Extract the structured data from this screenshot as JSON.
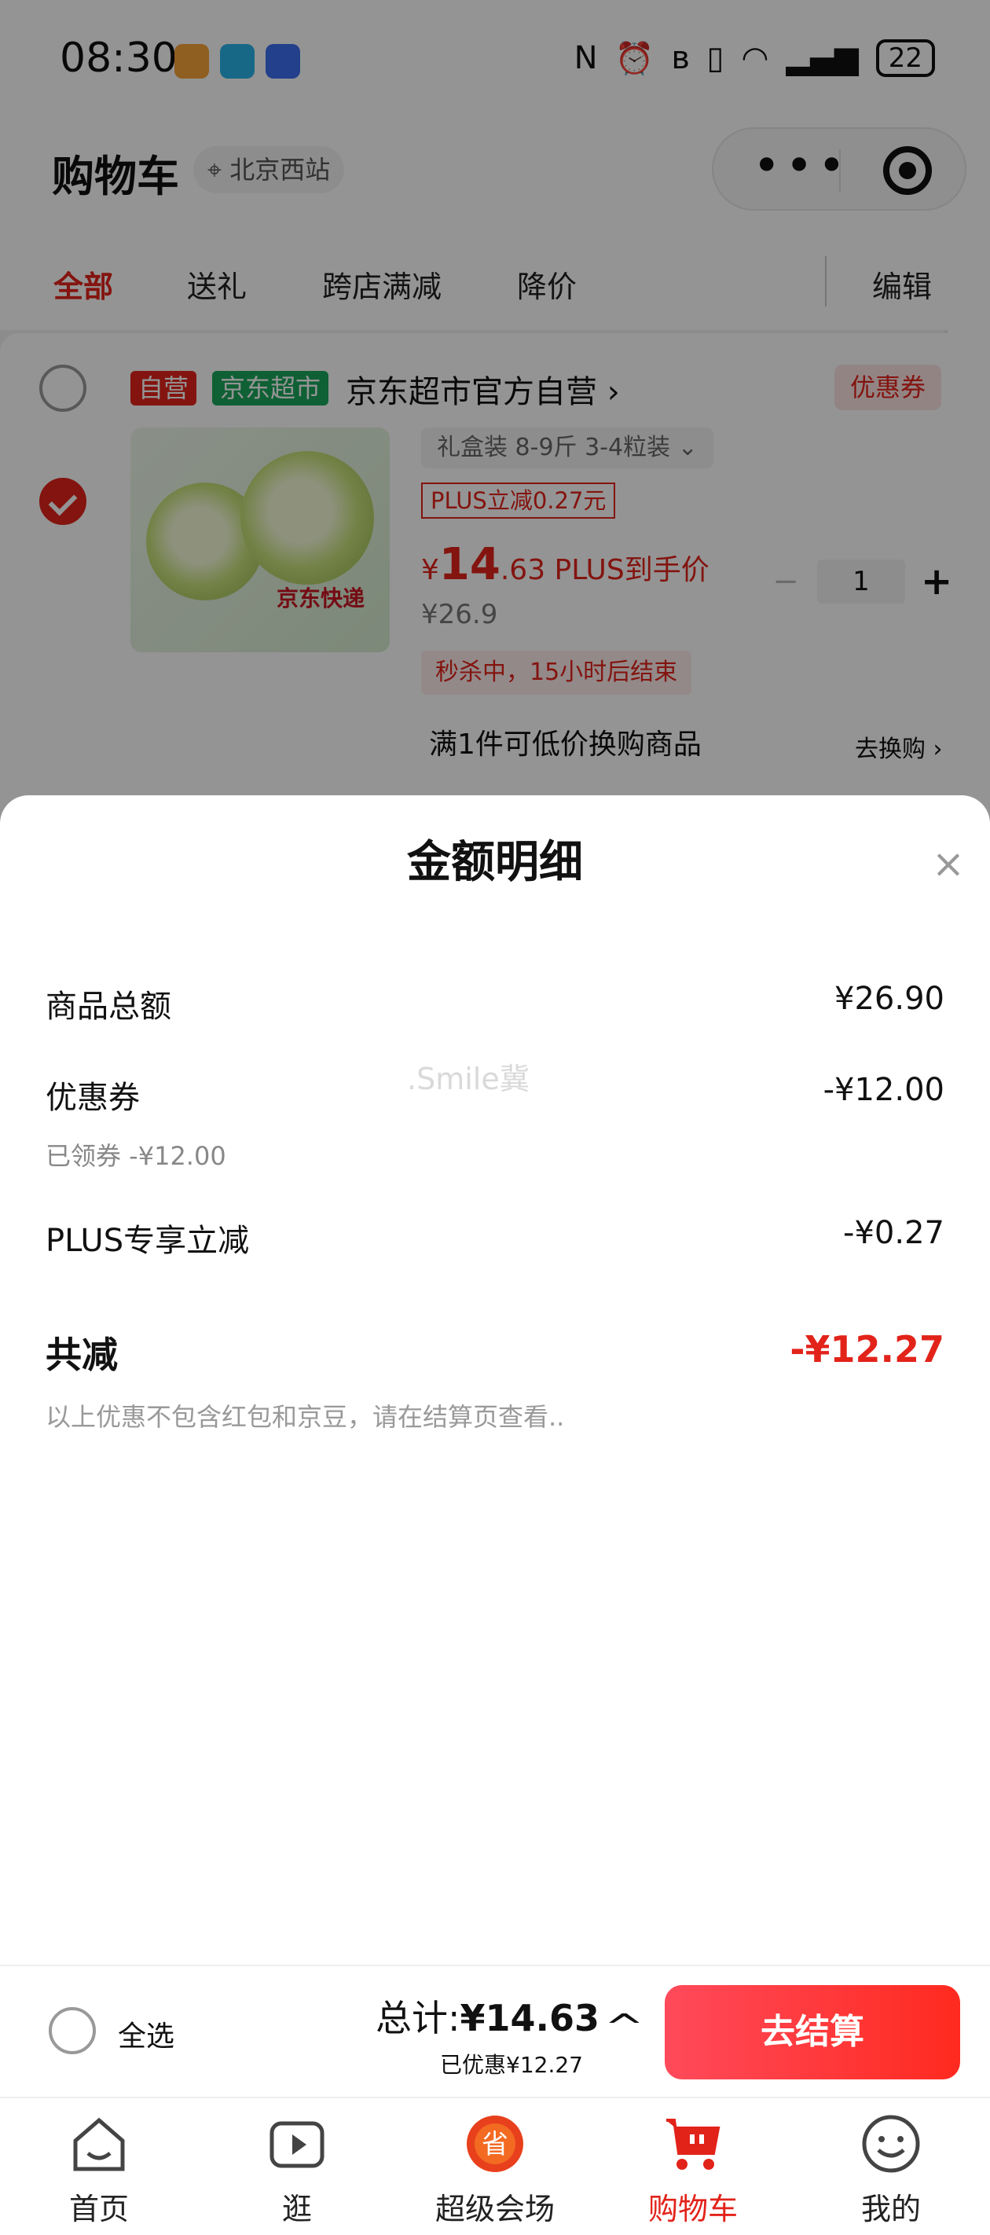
{
  "status_bar": {
    "time": "08:30",
    "battery": "22"
  },
  "header": {
    "title": "购物车",
    "location": "北京西站",
    "capsule_more": "•••",
    "floating_button": "+\n×"
  },
  "tabs": [
    {
      "label": "全部",
      "active": true
    },
    {
      "label": "送礼",
      "active": false
    },
    {
      "label": "跨店满减",
      "active": false
    },
    {
      "label": "降价",
      "active": false
    }
  ],
  "tabs_edit": "编辑",
  "shop": {
    "tag_self": "自营",
    "tag_store": "京东超市",
    "name": "京东超市官方自营 ›",
    "coupon": "优惠券",
    "product": {
      "image_text": "京东快递",
      "spec": "礼盒装 8-9斤 3-4粒装  ⌄",
      "plus_discount": "PLUS立减0.27元",
      "price_symbol": "¥",
      "price_int": "14",
      "price_dec": ".63",
      "price_suffix": " PLUS到手价",
      "original_price": "¥26.9",
      "quantity": "1",
      "flash_sale": "秒杀中，15小时后结束"
    },
    "exchange_text": "满1件可低价换购商品",
    "exchange_link": "去换购 ›"
  },
  "sheet": {
    "title": "金额明细",
    "close": "×",
    "watermark": ".Smile冀",
    "rows": [
      {
        "label": "商品总额",
        "value": "¥26.90"
      },
      {
        "label": "优惠券",
        "value": "-¥12.00",
        "sub": "已领券 -¥12.00"
      },
      {
        "label": "PLUS专享立减",
        "value": "-¥0.27"
      }
    ],
    "total_label": "共减",
    "total_value": "-¥12.27",
    "note": "以上优惠不包含红包和京豆，请在结算页查看.."
  },
  "checkout": {
    "select_all": "全选",
    "total_prefix": "总计:",
    "total_amount": "¥14.63",
    "discount": "已优惠¥12.27",
    "caret": "^",
    "button": "去结算"
  },
  "nav": [
    {
      "label": "首页",
      "icon": "home-icon",
      "active": false
    },
    {
      "label": "逛",
      "icon": "video-play-icon",
      "active": false
    },
    {
      "label": "超级会场",
      "icon": "super-venue-icon",
      "active": false
    },
    {
      "label": "购物车",
      "icon": "cart-icon",
      "active": true
    },
    {
      "label": "我的",
      "icon": "smiley-profile-icon",
      "active": false
    }
  ],
  "colors": {
    "accent": "#e2231a",
    "store_green": "#1aa55a"
  }
}
